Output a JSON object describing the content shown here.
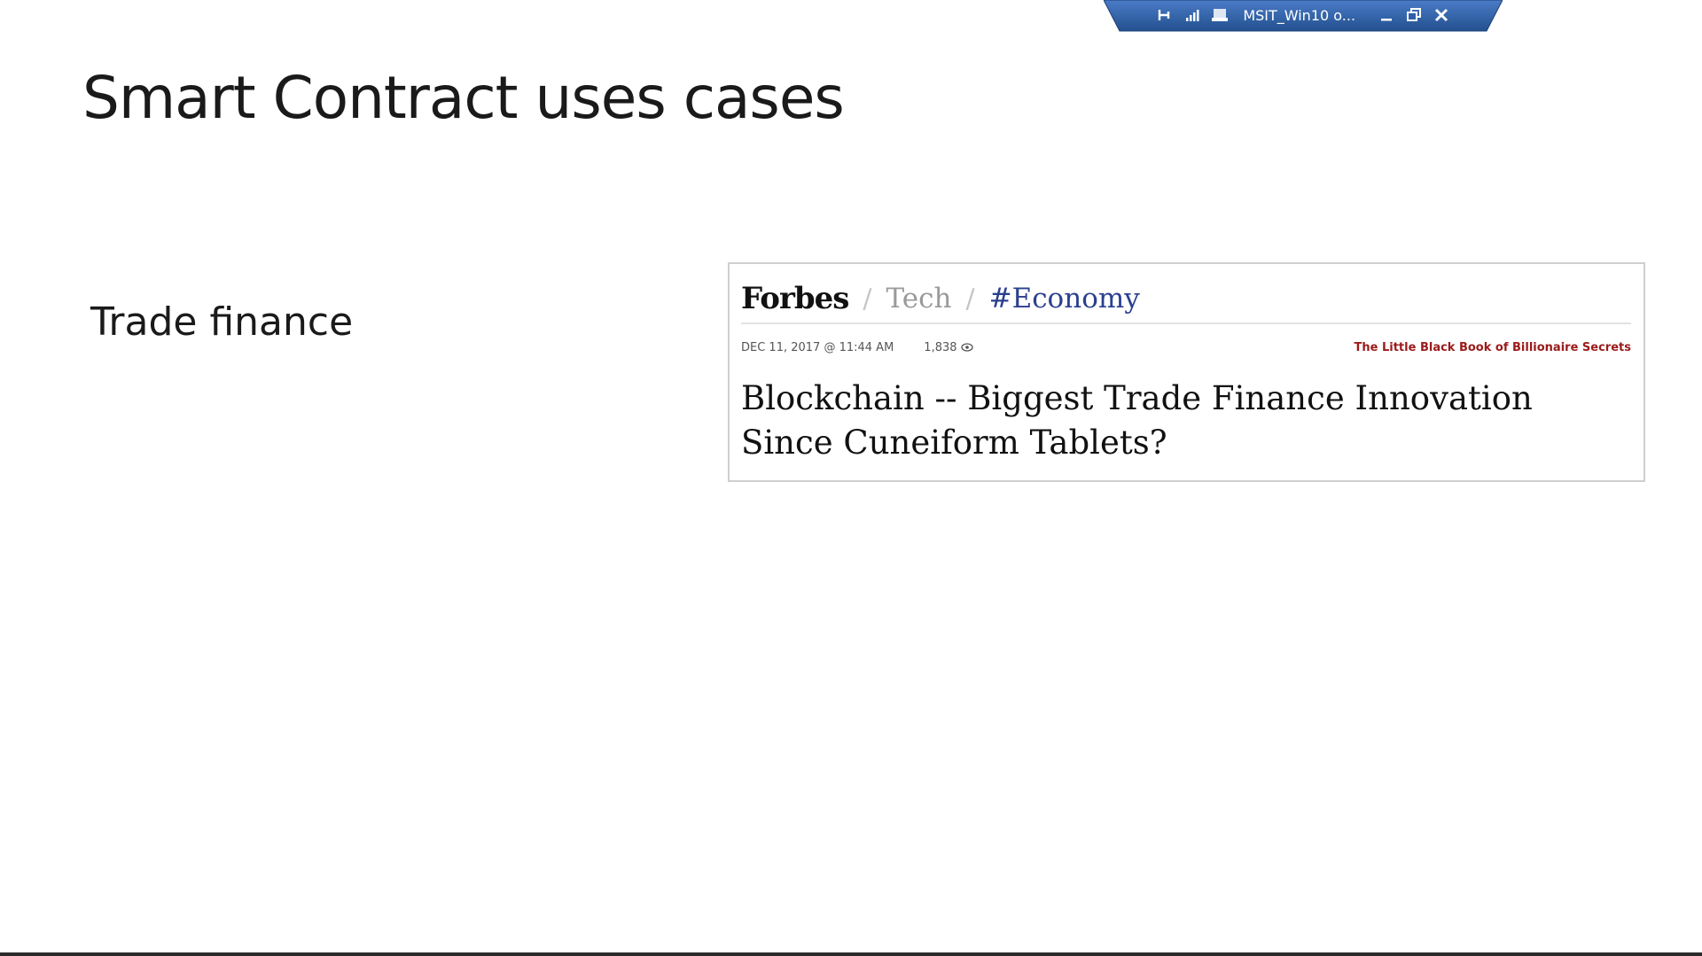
{
  "rdp_bar": {
    "title": "MSIT_Win10 o...",
    "icons": [
      "pin-icon",
      "signal-bars-icon",
      "computer-icon",
      "minimize-icon",
      "restore-icon",
      "close-icon"
    ],
    "color": "#2e5ea8"
  },
  "slide": {
    "title": "Smart Contract uses cases",
    "bullet": "Trade finance"
  },
  "article": {
    "brand": "Forbes",
    "separator": "/",
    "section": "Tech",
    "channel": "#Economy",
    "date": "DEC 11, 2017 @ 11:44 AM",
    "views": "1,838",
    "promo": "The Little Black Book of Billionaire Secrets",
    "headline": "Blockchain -- Biggest Trade Finance Innovation Since Cuneiform Tablets?",
    "colors": {
      "channel": "#2b3f8f",
      "promo": "#9b1a1a"
    }
  }
}
